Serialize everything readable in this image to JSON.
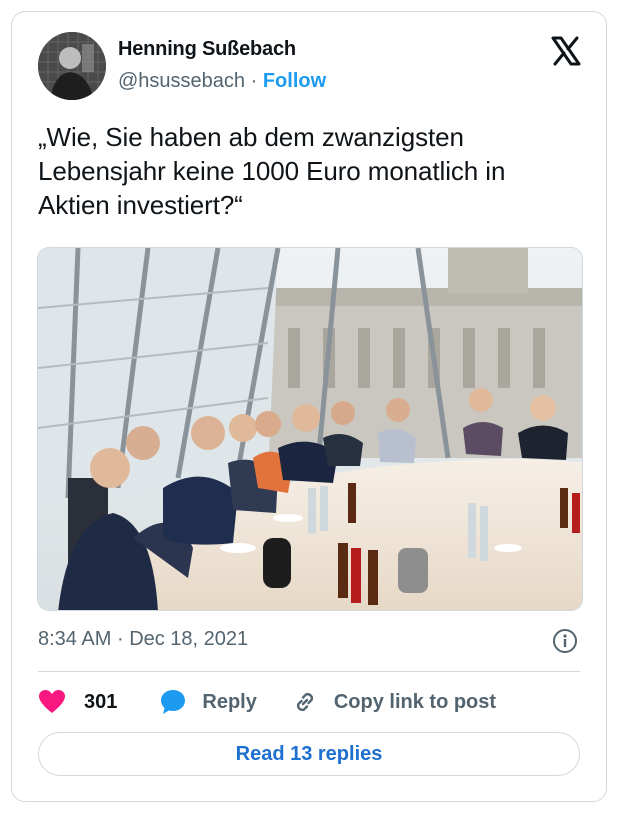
{
  "author": {
    "name": "Henning Sußebach",
    "handle": "@hsussebach",
    "separator": "·",
    "follow_label": "Follow"
  },
  "icons": {
    "platform": "x-logo-icon",
    "info": "info-icon",
    "like": "heart-icon",
    "reply": "speech-bubble-icon",
    "copy_link": "link-icon"
  },
  "tweet": {
    "text_lines": [
      "„Wie, Sie haben ab dem zwanzigsten",
      "Lebensjahr keine 1000 Euro monatlich in",
      "Aktien investiert?“"
    ]
  },
  "meta": {
    "time": "8:34 AM",
    "separator": "·",
    "date": "Dec 18, 2021"
  },
  "actions": {
    "like_count": "301",
    "reply_label": "Reply",
    "copy_link_label": "Copy link to post"
  },
  "read_replies_label": "Read 13 replies",
  "colors": {
    "accent": "#1d9bf0",
    "like": "#f91880",
    "text": "#0f1419",
    "secondary": "#536471",
    "border": "#cfd9de"
  }
}
